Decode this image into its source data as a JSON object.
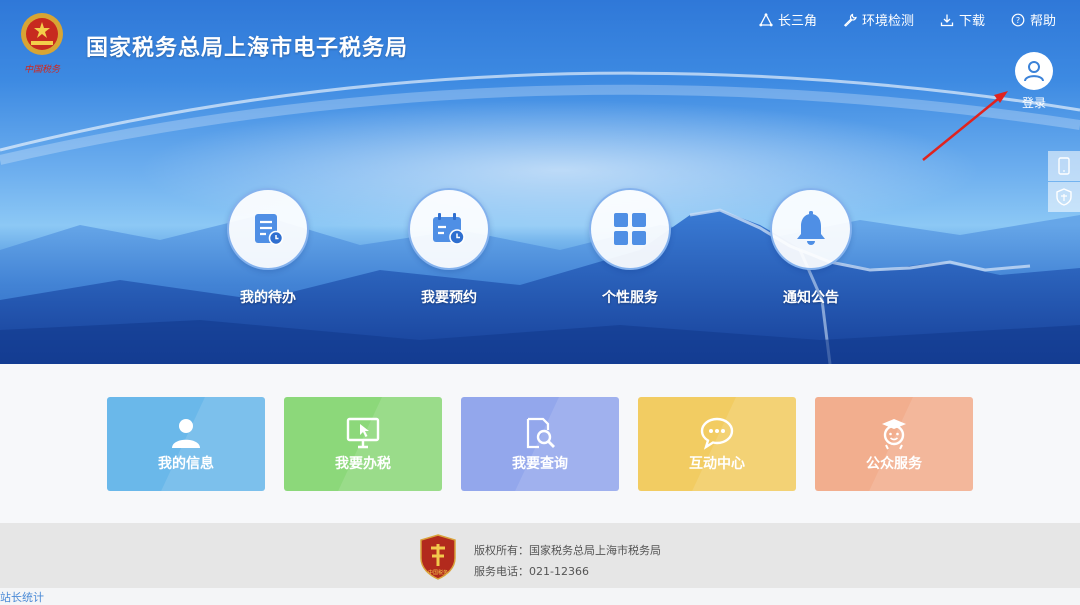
{
  "header": {
    "title": "国家税务总局上海市电子税务局",
    "emblem_caption": "中国税务"
  },
  "top_links": [
    {
      "label": "长三角",
      "icon": "triangle-icon"
    },
    {
      "label": "环境检测",
      "icon": "wrench-icon"
    },
    {
      "label": "下载",
      "icon": "download-icon"
    },
    {
      "label": "帮助",
      "icon": "help-circle-icon"
    }
  ],
  "login": {
    "label": "登录",
    "icon": "user-icon"
  },
  "side_tabs": [
    {
      "icon": "mobile-icon"
    },
    {
      "icon": "shield-tax-icon"
    }
  ],
  "quick_entries": [
    {
      "label": "我的待办",
      "icon": "todo-list-icon"
    },
    {
      "label": "我要预约",
      "icon": "calendar-clock-icon"
    },
    {
      "label": "个性服务",
      "icon": "grid-icon"
    },
    {
      "label": "通知公告",
      "icon": "bell-icon"
    }
  ],
  "cards": [
    {
      "label": "我的信息",
      "icon": "person-icon",
      "color": "#6ab8ea"
    },
    {
      "label": "我要办税",
      "icon": "monitor-cursor-icon",
      "color": "#8cd87a"
    },
    {
      "label": "我要查询",
      "icon": "document-search-icon",
      "color": "#93a7ec"
    },
    {
      "label": "互动中心",
      "icon": "chat-bubble-icon",
      "color": "#f2cc62"
    },
    {
      "label": "公众服务",
      "icon": "graduate-icon",
      "color": "#f2ae8e"
    }
  ],
  "footer": {
    "copyright": "版权所有：国家税务总局上海市税务局",
    "phone": "服务电话：021-12366",
    "logo_text": "中国税务"
  },
  "stats_link": "站长统计",
  "colors": {
    "banner_top": "#2f78d8",
    "annotation_arrow": "#e0231f",
    "footer_bg": "#e6e6e6"
  }
}
